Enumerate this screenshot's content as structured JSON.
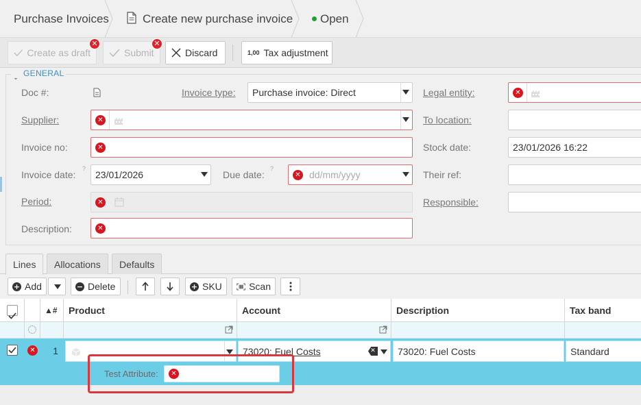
{
  "breadcrumb": {
    "root": "Purchase Invoices",
    "page": "Create new purchase invoice",
    "status": "Open",
    "status_color": "#1fa133"
  },
  "toolbar": {
    "create_draft": "Create as draft",
    "submit": "Submit",
    "discard": "Discard",
    "tax_adjustment": "Tax adjustment",
    "tax_icon_text": "1,00"
  },
  "general": {
    "section_title": "GENERAL",
    "doc_no_label": "Doc #:",
    "invoice_type_label": "Invoice type:",
    "invoice_type_value": "Purchase invoice: Direct",
    "legal_entity_label": "Legal entity:",
    "supplier_label": "Supplier:",
    "to_location_label": "To location:",
    "invoice_no_label": "Invoice no:",
    "stock_date_label": "Stock date:",
    "stock_date_value": "23/01/2026 16:22",
    "invoice_date_label": "Invoice date:",
    "invoice_date_value": "23/01/2026",
    "help_mark": "?",
    "due_date_label": "Due date:",
    "due_date_placeholder": "dd/mm/yyyy",
    "their_ref_label": "Their ref:",
    "period_label": "Period:",
    "responsible_label": "Responsible:",
    "description_label": "Description:"
  },
  "tabs": [
    "Lines",
    "Allocations",
    "Defaults"
  ],
  "lines_toolbar": {
    "add": "Add",
    "delete": "Delete",
    "sku": "SKU",
    "scan": "Scan"
  },
  "grid": {
    "sort_label": "▲#",
    "headers": {
      "product": "Product",
      "account": "Account",
      "description": "Description",
      "tax_band": "Tax band"
    },
    "row": {
      "line_no": "1",
      "account": "73020: Fuel Costs",
      "description": "73020: Fuel Costs",
      "tax_band": "Standard"
    },
    "detail_label": "Test Attribute:"
  },
  "colors": {
    "accent": "#3a90c8",
    "error": "#e0212a",
    "row_highlight": "#6ccde6",
    "callout": "#d9363e"
  }
}
